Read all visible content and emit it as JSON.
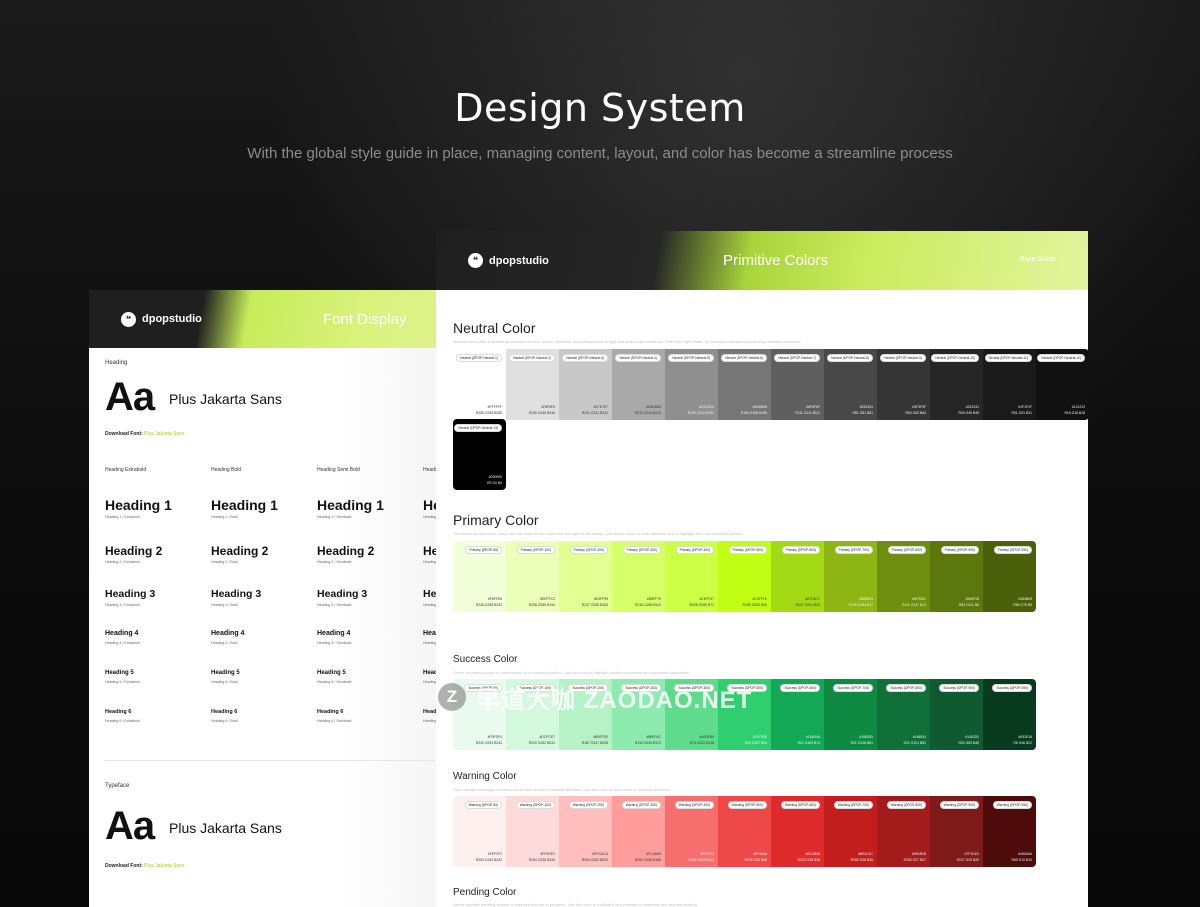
{
  "hero": {
    "title": "Design System",
    "subtitle": "With the global style guide in place, managing content, layout, and color has become a streamline process"
  },
  "font_card": {
    "logo_mark": "❝",
    "logo": "dpopstudio",
    "title": "Font Display",
    "heading_label": "Heading",
    "aa": "Aa",
    "family": "Plus Jakarta Sans",
    "download_label": "Download Font:",
    "download_link": "Plus Jakarta Sans",
    "columns": [
      "Heading Extrabold",
      "Heading Bold",
      "Heading Semi Bold"
    ],
    "weights": [
      "Extrabold",
      "Bold",
      "Semibold"
    ],
    "headings": [
      "Heading 1",
      "Heading 2",
      "Heading 3",
      "Heading 4",
      "Heading 5",
      "Heading 6"
    ],
    "typeface_label": "Typeface"
  },
  "color_card": {
    "logo_mark": "❝",
    "logo": "dpopstudio",
    "title": "Primitive Colors",
    "right_label": "Style Guide",
    "sections": [
      {
        "title": "Neutral Color",
        "description": "Neutral colors offer a familiar appearance for text, border elements, and backgrounds in light and dark mode interfaces. Select the right shade by checking contrast and ensuring readable interfaces.",
        "swatches": [
          {
            "name": "Neutral (DPOP-Neutral-1)",
            "hex": "#FFFFFF",
            "rgb": "R255 G255 B255",
            "color": "#FFFFFF"
          },
          {
            "name": "Neutral (DPOP-Neutral-2)",
            "hex": "#F6F6F6",
            "rgb": "R246 G246 B246",
            "color": "#E0E0E0"
          },
          {
            "name": "Neutral (DPOP-Neutral-3)",
            "hex": "#E7E7E7",
            "rgb": "R231 G231 B231",
            "color": "#C8C8C8"
          },
          {
            "name": "Neutral (DPOP-Neutral-4)",
            "hex": "#D5D5D5",
            "rgb": "R213 G213 B213",
            "color": "#A9A9A9"
          },
          {
            "name": "Neutral (DPOP-Neutral-5)",
            "hex": "#C0C0C0",
            "rgb": "R192 G192 B192",
            "color": "#8F8F8F"
          },
          {
            "name": "Neutral (DPOP-Neutral-6)",
            "hex": "#9B9B9B",
            "rgb": "R155 G155 B155",
            "color": "#767676"
          },
          {
            "name": "Neutral (DPOP-Neutral-7)",
            "hex": "#6F6F6F",
            "rgb": "R111 G111 B111",
            "color": "#5F5F5F"
          },
          {
            "name": "Neutral (DPOP-Neutral-8)",
            "hex": "#515151",
            "rgb": "R81 G81 B81",
            "color": "#484848"
          },
          {
            "name": "Neutral (DPOP-Neutral-9)",
            "hex": "#3F3F3F",
            "rgb": "R63 G63 B63",
            "color": "#353535"
          },
          {
            "name": "Neutral (DPOP-Neutral-10)",
            "hex": "#313131",
            "rgb": "R49 G49 B49",
            "color": "#262626"
          },
          {
            "name": "Neutral (DPOP-Neutral-11)",
            "hex": "#1F1F1F",
            "rgb": "R31 G31 B31",
            "color": "#1A1A1A"
          },
          {
            "name": "Neutral (DPOP-Neutral-12)",
            "hex": "#121212",
            "rgb": "R18 G18 B18",
            "color": "#111111"
          },
          {
            "name": "Neutral (DPOP-Neutral-13)",
            "hex": "#000000",
            "rgb": "R0 G0 B0",
            "color": "#000000"
          }
        ]
      },
      {
        "title": "Primary Color",
        "description": "The colors represent the brand and are used as the main color throughout the design. Use these colors to draw attention and to highlight the most important actions.",
        "swatches": [
          {
            "name": "Primary (DPOP-50)",
            "hex": "#F8FFE6",
            "rgb": "R248 G255 B230",
            "color": "#F3FFD8"
          },
          {
            "name": "Primary (DPOP-100)",
            "hex": "#EEFFC2",
            "rgb": "R238 G255 B194",
            "color": "#EBFFB8"
          },
          {
            "name": "Primary (DPOP-200)",
            "hex": "#E3FF99",
            "rgb": "R227 G255 B153",
            "color": "#E1FF93"
          },
          {
            "name": "Primary (DPOP-300)",
            "hex": "#D8FF70",
            "rgb": "R216 G255 B112",
            "color": "#D6FF6A"
          },
          {
            "name": "Primary (DPOP-400)",
            "hex": "#CEFF47",
            "rgb": "R206 G255 B71",
            "color": "#CCFF46"
          },
          {
            "name": "Primary (DPOP-500)",
            "hex": "#C3FF1E",
            "rgb": "R195 G255 B30",
            "color": "#C0FF14"
          },
          {
            "name": "Primary (DPOP-600)",
            "hex": "#A7DD17",
            "rgb": "R167 G221 B23",
            "color": "#A3D915"
          },
          {
            "name": "Primary (DPOP-700)",
            "hex": "#8BB811",
            "rgb": "R139 G184 B17",
            "color": "#8DB513"
          },
          {
            "name": "Primary (DPOP-800)",
            "hex": "#6F930C",
            "rgb": "R111 G147 B12",
            "color": "#6E8E10"
          },
          {
            "name": "Primary (DPOP-900)",
            "hex": "#536F08",
            "rgb": "R83 G111 B8",
            "color": "#5C770B"
          },
          {
            "name": "Primary (DPOP-950)",
            "hex": "#384B05",
            "rgb": "R56 G75 B5",
            "color": "#4A600A"
          }
        ]
      },
      {
        "title": "Success Color",
        "description": "Green denotes success or confirmation of a completed action. Use this color to highlight positive outcomes and successful operations.",
        "swatches": [
          {
            "name": "Success (DPOP-50)",
            "hex": "#F0FDF4",
            "rgb": "R240 G253 B244",
            "color": "#E9FBEF"
          },
          {
            "name": "Success (DPOP-100)",
            "hex": "#DCFCE7",
            "rgb": "R220 G252 B231",
            "color": "#D2F8DD"
          },
          {
            "name": "Success (DPOP-200)",
            "hex": "#BBF7D0",
            "rgb": "R187 G247 B208",
            "color": "#B7F2C6"
          },
          {
            "name": "Success (DPOP-300)",
            "hex": "#86EFAC",
            "rgb": "R134 G239 B172",
            "color": "#8DEBB0"
          },
          {
            "name": "Success (DPOP-400)",
            "hex": "#4ADE80",
            "rgb": "R74 G222 B128",
            "color": "#5FDC8B"
          },
          {
            "name": "Success (DPOP-500)",
            "hex": "#22C55E",
            "rgb": "R34 G197 B94",
            "color": "#2FCF70"
          },
          {
            "name": "Success (DPOP-600)",
            "hex": "#16A34A",
            "rgb": "R22 G163 B74",
            "color": "#13A856"
          },
          {
            "name": "Success (DPOP-700)",
            "hex": "#15803D",
            "rgb": "R21 G128 B61",
            "color": "#0E8A43"
          },
          {
            "name": "Success (DPOP-800)",
            "hex": "#166534",
            "rgb": "R22 G101 B52",
            "color": "#116F39"
          },
          {
            "name": "Success (DPOP-900)",
            "hex": "#14532D",
            "rgb": "R20 G83 B45",
            "color": "#0F5A30"
          },
          {
            "name": "Success (DPOP-950)",
            "hex": "#052E16",
            "rgb": "R5 G46 B22",
            "color": "#083A1E"
          }
        ]
      },
      {
        "title": "Warning Color",
        "description": "Red indicates warnings or critical issues that require immediate attention. Use this color to alert users to potential problems.",
        "swatches": [
          {
            "name": "Warning (DPOP-50)",
            "hex": "#FEF2F2",
            "rgb": "R254 G242 B242",
            "color": "#FFF0F0"
          },
          {
            "name": "Warning (DPOP-100)",
            "hex": "#FEE2E2",
            "rgb": "R254 G226 B226",
            "color": "#FFDADA"
          },
          {
            "name": "Warning (DPOP-200)",
            "hex": "#FECACA",
            "rgb": "R254 G202 B202",
            "color": "#FFBDBD"
          },
          {
            "name": "Warning (DPOP-300)",
            "hex": "#FCA5A5",
            "rgb": "R252 G165 B165",
            "color": "#FF9C9C"
          },
          {
            "name": "Warning (DPOP-400)",
            "hex": "#F87171",
            "rgb": "R248 G113 B113",
            "color": "#F76E6E"
          },
          {
            "name": "Warning (DPOP-500)",
            "hex": "#EF4444",
            "rgb": "R239 G68 B68",
            "color": "#EE4848"
          },
          {
            "name": "Warning (DPOP-600)",
            "hex": "#DC2626",
            "rgb": "R220 G38 B38",
            "color": "#DF2B2B"
          },
          {
            "name": "Warning (DPOP-700)",
            "hex": "#B91C1C",
            "rgb": "R185 G28 B28",
            "color": "#C21E1E"
          },
          {
            "name": "Warning (DPOP-800)",
            "hex": "#991B1B",
            "rgb": "R153 G27 B27",
            "color": "#A31B1B"
          },
          {
            "name": "Warning (DPOP-900)",
            "hex": "#7F1D1D",
            "rgb": "R127 G29 B29",
            "color": "#7E1A1A"
          },
          {
            "name": "Warning (DPOP-950)",
            "hex": "#450A0A",
            "rgb": "R69 G10 B10",
            "color": "#4E0B0B"
          }
        ]
      },
      {
        "title": "Pending Color",
        "description": "Yellow signifies pending actions or statuses that are in progress. Use this color to indicate that a process is underway and requires waiting.",
        "swatches": []
      }
    ]
  },
  "watermark": {
    "mark": "Z",
    "text": "早道大咖 ZAODAO.NET"
  }
}
